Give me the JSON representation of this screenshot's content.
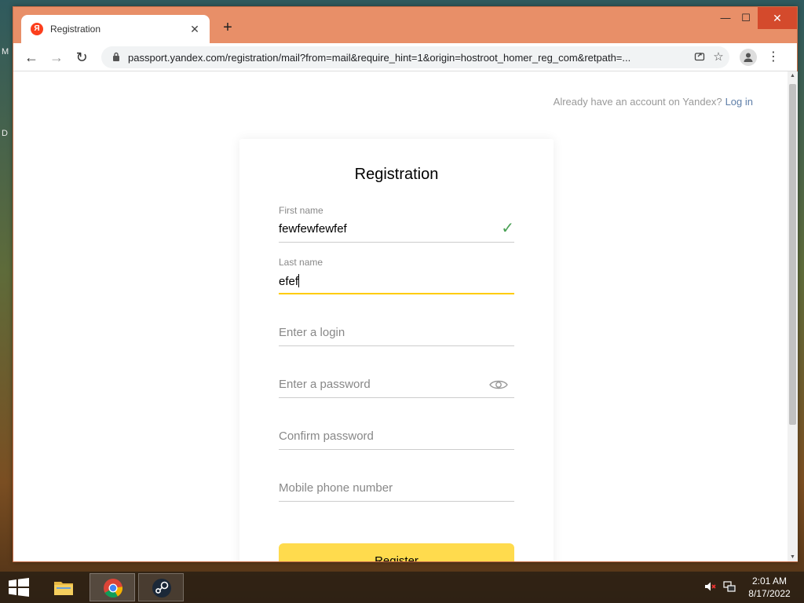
{
  "desktop": {
    "icon_letter_1": "M",
    "icon_letter_2": "D"
  },
  "browser": {
    "tab": {
      "title": "Registration",
      "favicon_letter": "Я",
      "close_glyph": "✕"
    },
    "new_tab_glyph": "+",
    "window_controls": {
      "minimize": "—",
      "maximize": "☐",
      "close": "✕"
    },
    "nav": {
      "back": "←",
      "forward": "→",
      "reload": "↻"
    },
    "url": "passport.yandex.com/registration/mail?from=mail&require_hint=1&origin=hostroot_homer_reg_com&retpath=...",
    "icons": [
      "lock-icon",
      "share-icon",
      "star-icon",
      "profile-icon",
      "menu-icon"
    ]
  },
  "page": {
    "already_text": "Already have an account on Yandex?",
    "login_link": "Log in",
    "title": "Registration",
    "fields": {
      "first_name": {
        "label": "First name",
        "value": "fewfewfewfef",
        "valid": true
      },
      "last_name": {
        "label": "Last name",
        "value": "efef",
        "focused": true
      },
      "login": {
        "placeholder": "Enter a login"
      },
      "password": {
        "placeholder": "Enter a password"
      },
      "confirm_password": {
        "placeholder": "Confirm password"
      },
      "phone": {
        "placeholder": "Mobile phone number"
      }
    },
    "register_button": "Register",
    "accent_color": "#ffdb4d",
    "link_color": "#5e7ea8"
  },
  "taskbar": {
    "apps": [
      "file-explorer",
      "chrome",
      "steam"
    ],
    "time": "2:01 AM",
    "date": "8/17/2022"
  }
}
